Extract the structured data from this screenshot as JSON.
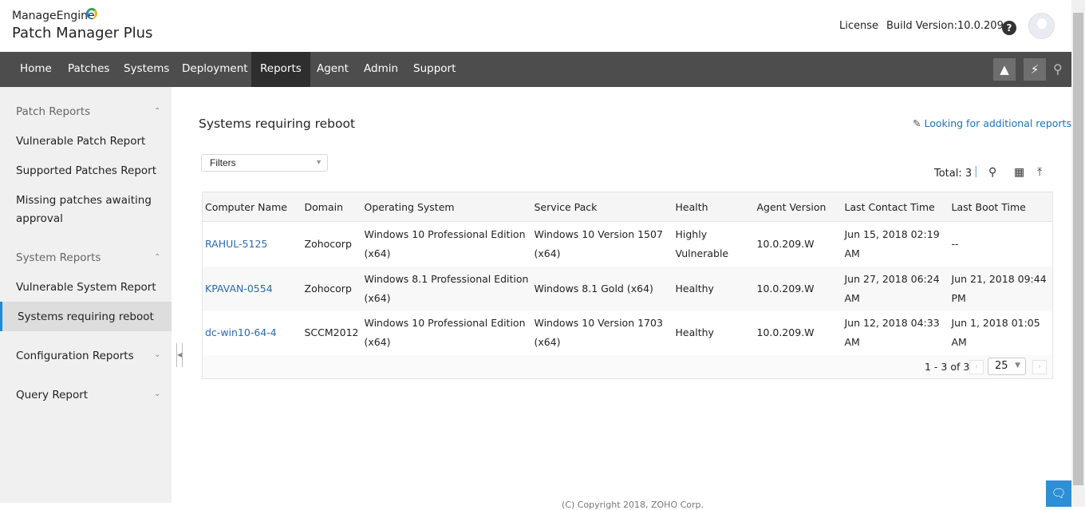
{
  "header": {
    "brand": "ManageEngine",
    "product": "Patch Manager Plus",
    "license": "License",
    "build": "Build Version:10.0.209"
  },
  "nav": {
    "items": [
      "Home",
      "Patches",
      "Systems",
      "Deployment",
      "Reports",
      "Agent",
      "Admin",
      "Support"
    ],
    "active": "Reports"
  },
  "sidebar": {
    "patch_reports": "Patch Reports",
    "vulnerable_patch": "Vulnerable Patch Report",
    "supported_patches": "Supported Patches Report",
    "missing_1": "Missing patches awaiting",
    "missing_2": "approval",
    "system_reports": "System Reports",
    "vulnerable_system": "Vulnerable System Report",
    "reboot": "Systems requiring reboot",
    "configuration": "Configuration Reports",
    "query": "Query Report"
  },
  "main": {
    "title": "Systems requiring reboot",
    "additional": "Looking for additional reports?",
    "filters": "Filters",
    "total": "Total: 3"
  },
  "table": {
    "headers": [
      "Computer Name",
      "Domain",
      "Operating System",
      "Service Pack",
      "Health",
      "Agent Version",
      "Last Contact Time",
      "Last Boot Time"
    ],
    "rows": [
      [
        "RAHUL-5125",
        "Zohocorp",
        "Windows 10 Professional Edition (x64)",
        "Windows 10 Version 1507 (x64)",
        "Highly Vulnerable",
        "10.0.209.W",
        "Jun 15, 2018 02:19 AM",
        "--"
      ],
      [
        "KPAVAN-0554",
        "Zohocorp",
        "Windows 8.1 Professional Edition (x64)",
        "Windows 8.1 Gold (x64)",
        "Healthy",
        "10.0.209.W",
        "Jun 27, 2018 06:24 AM",
        "Jun 21, 2018 09:44 PM"
      ],
      [
        "dc-win10-64-4",
        "SCCM2012",
        "Windows 10 Professional Edition (x64)",
        "Windows 10 Version 1703 (x64)",
        "Healthy",
        "10.0.209.W",
        "Jun 12, 2018 04:33 AM",
        "Jun 1, 2018 01:05 AM"
      ]
    ]
  },
  "pagination": {
    "info": "1 - 3 of 3",
    "per_page": "25"
  },
  "footer": "(C) Copyright 2018, ZOHO Corp."
}
